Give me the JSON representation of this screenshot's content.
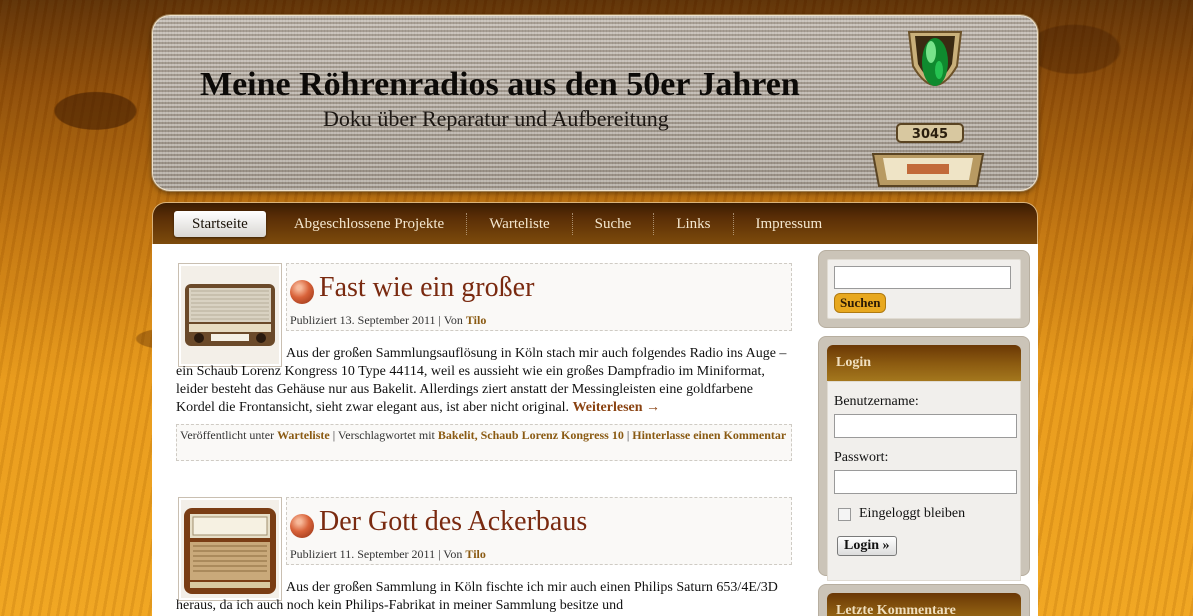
{
  "header": {
    "title": "Meine Röhrenradios aus den 50er Jahren",
    "description": "Doku über Reparatur und Aufbereitung",
    "dial_number": "3045"
  },
  "nav": {
    "items": [
      "Startseite",
      "Abgeschlossene Projekte",
      "Warteliste",
      "Suche",
      "Links",
      "Impressum"
    ],
    "active": "Startseite"
  },
  "posts": [
    {
      "title": "Fast wie ein großer",
      "published_label": "Publiziert",
      "date": "13. September 2011",
      "by_label": "| Von",
      "author": "Tilo",
      "excerpt": "Aus der großen Sammlungsauflösung in Köln stach mir auch folgendes Radio ins Auge – ein Schaub Lorenz Kongress 10 Type 44114, weil es aussieht wie ein großes Dampfradio im Miniformat, leider besteht das Gehäuse nur aus Bakelit. Allerdings ziert anstatt der Messingleisten eine goldfarbene Kordel die Frontansicht, sieht zwar elegant aus, ist aber nicht original.",
      "read_more": "Weiterlesen →",
      "posted_in_label": "Veröffentlicht unter",
      "category": "Warteliste",
      "tagged_label": "| Verschlagwortet mit",
      "tags": "Bakelit, Schaub Lorenz Kongress 10",
      "comment_link": "Hinterlasse einen Kommentar"
    },
    {
      "title": "Der Gott des Ackerbaus",
      "published_label": "Publiziert",
      "date": "11. September 2011",
      "by_label": "| Von",
      "author": "Tilo",
      "excerpt": "Aus der großen Sammlung in Köln fischte ich mir auch einen Philips Saturn 653/4E/3D heraus, da ich auch noch kein Philips-Fabrikat in meiner Sammlung besitze und"
    }
  ],
  "sidebar": {
    "search_button": "Suchen",
    "login": {
      "title": "Login",
      "username_label": "Benutzername:",
      "password_label": "Passwort:",
      "remember_label": "Eingeloggt bleiben",
      "button": "Login »"
    },
    "recent_comments_title": "Letzte Kommentare"
  },
  "colors": {
    "accent_link": "#8a5a12",
    "post_title": "#7a2a10",
    "search_button": "#e8a81f"
  }
}
